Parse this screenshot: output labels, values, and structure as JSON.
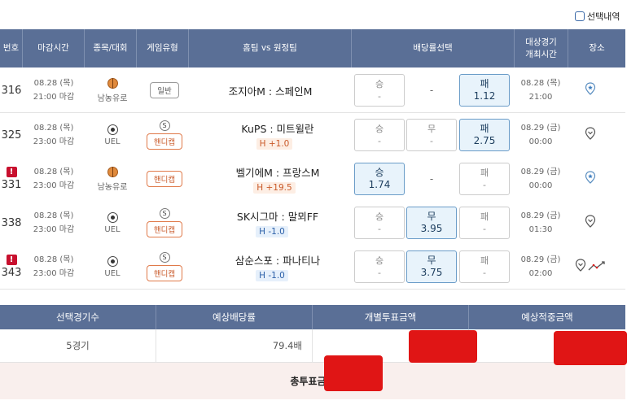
{
  "top": {
    "select_history_label": "선택내역"
  },
  "columns": {
    "num": "번호",
    "deadline": "마감시간",
    "sport": "종목/대회",
    "game_type": "게임유형",
    "teams": "홈팀 vs 원정팀",
    "odds": "배당률선택",
    "venue_date_1": "대상경기",
    "venue_date_2": "개최시간",
    "venue": "장소"
  },
  "rows": [
    {
      "num": "316",
      "flag": "",
      "date": "08.28 (목)",
      "time": "21:00 마감",
      "league": "남농유로",
      "sport_icon": "basketball-icon",
      "game_type": "일반",
      "game_symbol": "",
      "teams": "조지아M : 스페인M",
      "handicap": "",
      "win": {
        "label": "승",
        "val": "-"
      },
      "draw": "-",
      "lose": {
        "label": "패",
        "val": "1.12"
      },
      "selected": "lose",
      "vdate": "08.28 (목)",
      "vtime": "21:00",
      "venue_icon": "star-pin-icon"
    },
    {
      "num": "325",
      "flag": "",
      "date": "08.28 (목)",
      "time": "23:00 마감",
      "league": "UEL",
      "sport_icon": "soccer-icon",
      "game_type": "핸디캡",
      "game_symbol": "S",
      "teams": "KuPS : 미트윌란",
      "handicap": "H +1.0",
      "win": {
        "label": "승",
        "val": "-"
      },
      "draw": {
        "label": "무",
        "val": "-"
      },
      "lose": {
        "label": "패",
        "val": "2.75"
      },
      "selected": "lose",
      "vdate": "08.29 (금)",
      "vtime": "00:00",
      "venue_icon": "pin-icon"
    },
    {
      "num": "331",
      "flag": "!",
      "date": "08.28 (목)",
      "time": "23:00 마감",
      "league": "남농유로",
      "sport_icon": "basketball-icon",
      "game_type": "핸디캡",
      "game_symbol": "",
      "teams": "벨기에M : 프랑스M",
      "handicap": "H +19.5",
      "win": {
        "label": "승",
        "val": "1.74"
      },
      "draw": "-",
      "lose": {
        "label": "패",
        "val": "-"
      },
      "selected": "win",
      "vdate": "08.29 (금)",
      "vtime": "00:00",
      "venue_icon": "star-pin-icon"
    },
    {
      "num": "338",
      "flag": "",
      "date": "08.28 (목)",
      "time": "23:00 마감",
      "league": "UEL",
      "sport_icon": "soccer-icon",
      "game_type": "핸디캡",
      "game_symbol": "S",
      "teams": "SK시그마 : 말뫼FF",
      "handicap": "H -1.0",
      "win": {
        "label": "승",
        "val": "-"
      },
      "draw": {
        "label": "무",
        "val": "3.95"
      },
      "lose": {
        "label": "패",
        "val": "-"
      },
      "selected": "draw",
      "vdate": "08.29 (금)",
      "vtime": "01:30",
      "venue_icon": "pin-icon"
    },
    {
      "num": "343",
      "flag": "!",
      "date": "08.28 (목)",
      "time": "23:00 마감",
      "league": "UEL",
      "sport_icon": "soccer-icon",
      "game_type": "핸디캡",
      "game_symbol": "S",
      "teams": "삼순스포 : 파나티나",
      "handicap": "H -1.0",
      "win": {
        "label": "승",
        "val": "-"
      },
      "draw": {
        "label": "무",
        "val": "3.75"
      },
      "lose": {
        "label": "패",
        "val": "-"
      },
      "selected": "draw",
      "vdate": "08.29 (금)",
      "vtime": "02:00",
      "venue_icon": "pin-icon"
    }
  ],
  "summary": {
    "headers": [
      "선택경기수",
      "예상배당률",
      "개별투표금액",
      "예상적중금액"
    ],
    "selected_count": "5경기",
    "expected_odds": "79.4배",
    "total_label": "총투표금액"
  }
}
